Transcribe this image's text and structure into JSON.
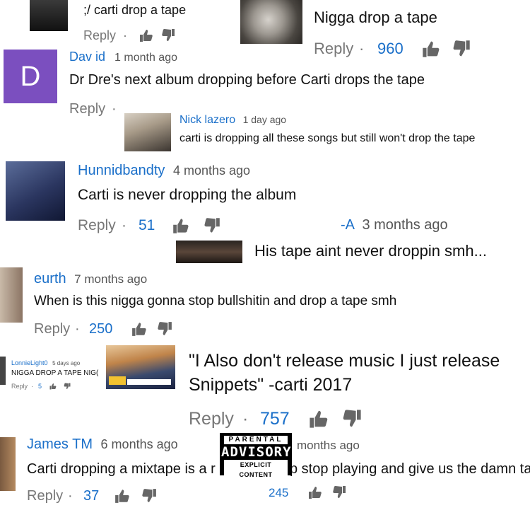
{
  "comments": [
    {
      "id": "c1",
      "text": ";/ carti drop a tape",
      "reply_label": "Reply"
    },
    {
      "id": "c2",
      "text": "Nigga drop a tape",
      "reply_label": "Reply",
      "count": "960"
    },
    {
      "id": "c3",
      "author": "Dav id",
      "time": "1 month ago",
      "avatar_letter": "D",
      "text": "Dr Dre's next album dropping before Carti drops the tape",
      "reply_label": "Reply"
    },
    {
      "id": "c4",
      "author": "Nick lazero",
      "time": "1 day ago",
      "text": "carti is dropping all these songs but still won't drop the tape"
    },
    {
      "id": "c5",
      "author": "Hunnidbandty",
      "time": "4 months ago",
      "text": "Carti is never dropping the album",
      "reply_label": "Reply",
      "count": "51"
    },
    {
      "id": "c6",
      "author": "-A",
      "time": "3 months ago",
      "text": "His tape aint never droppin smh..."
    },
    {
      "id": "c7",
      "author": "eurth",
      "time": "7 months ago",
      "text": "When is this nigga gonna stop bullshitin and drop a tape smh",
      "reply_label": "Reply",
      "count": "250"
    },
    {
      "id": "c8",
      "author": "LonnieLight0",
      "time": "5 days ago",
      "text": "NIGGA DROP A TAPE NIG(",
      "reply_label": "Reply",
      "count": "5"
    },
    {
      "id": "c9",
      "text_line1": "\"I Also don't release music I just release",
      "text_line2": "Snippets\" -carti 2017",
      "reply_label": "Reply",
      "count": "757"
    },
    {
      "id": "c10",
      "author": "James TM",
      "time": "6 months ago",
      "text_left": "Carti dropping a mixtape is a r",
      "text_right": "p stop playing and give us the damn tap",
      "reply_label": "Reply",
      "count": "37"
    },
    {
      "id": "c11",
      "time": "months ago",
      "count": "245"
    }
  ],
  "advisory": {
    "line1": "PARENTAL",
    "line2": "ADVISORY",
    "line3": "EXPLICIT CONTENT"
  },
  "icons": {
    "like": "thumbs-up-icon",
    "dislike": "thumbs-down-icon"
  },
  "colors": {
    "link": "#1a6fc9",
    "avatar_purple": "#7b4fbf"
  }
}
